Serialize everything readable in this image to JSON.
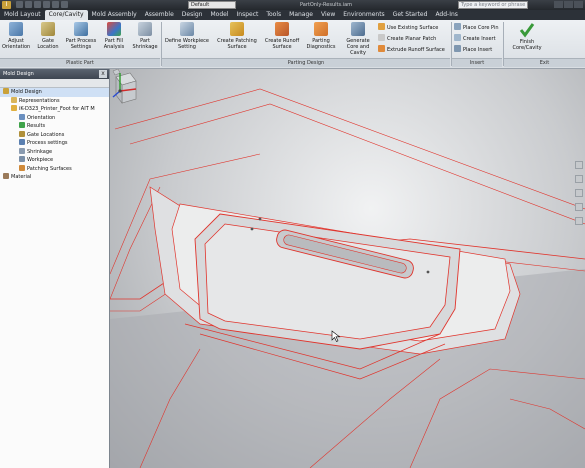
{
  "titlebar": {
    "app_button": "I",
    "style_combo": "Default",
    "document_title": "PartOnly-Results.iam",
    "search_placeholder": "Type a keyword or phrase"
  },
  "ribbon_tabs": [
    {
      "label": "Mold Layout",
      "active": false
    },
    {
      "label": "Core/Cavity",
      "active": true
    },
    {
      "label": "Mold Assembly",
      "active": false
    },
    {
      "label": "Assemble",
      "active": false
    },
    {
      "label": "Design",
      "active": false
    },
    {
      "label": "Model",
      "active": false
    },
    {
      "label": "Inspect",
      "active": false
    },
    {
      "label": "Tools",
      "active": false
    },
    {
      "label": "Manage",
      "active": false
    },
    {
      "label": "View",
      "active": false
    },
    {
      "label": "Environments",
      "active": false
    },
    {
      "label": "Get Started",
      "active": false
    },
    {
      "label": "Add-Ins",
      "active": false
    }
  ],
  "ribbon": {
    "plastic_part": {
      "label": "Plastic Part",
      "adjust_orientation": "Adjust Orientation",
      "gate_location": "Gate Location",
      "part_process_settings": "Part Process Settings",
      "part_fill_analysis": "Part Fill Analysis",
      "part_shrinkage": "Part Shrinkage"
    },
    "parting_design": {
      "label": "Parting Design",
      "define_workpiece_setting": "Define Workpiece Setting",
      "create_patching_surface": "Create Patching Surface",
      "create_runoff_surface": "Create Runoff Surface",
      "parting_diagnostics": "Parting Diagnostics",
      "generate_core_and_cavity": "Generate Core and Cavity",
      "use_existing_surface": "Use Existing Surface",
      "create_planar_patch": "Create Planar Patch",
      "extrude_runoff_surface": "Extrude Runoff Surface"
    },
    "insert": {
      "label": "Insert",
      "place_core_pin": "Place Core Pin",
      "create_insert": "Create Insert",
      "place_insert": "Place Insert"
    },
    "exit": {
      "label": "Exit",
      "finish_core_cavity": "Finish Core/Cavity"
    }
  },
  "browser": {
    "title": "Mold Design",
    "close_glyph": "x",
    "items": [
      {
        "label": "Mold Design",
        "indent": 0,
        "icon": "assembly-icon"
      },
      {
        "label": "Representations",
        "indent": 1,
        "icon": "folder-icon"
      },
      {
        "label": "iK-D323_Printer_Foot for AIT M",
        "indent": 1,
        "icon": "part-icon"
      },
      {
        "label": "Orientation",
        "indent": 2,
        "icon": "orientation-icon"
      },
      {
        "label": "Results",
        "indent": 2,
        "icon": "results-icon"
      },
      {
        "label": "Gate Locations",
        "indent": 2,
        "icon": "gate-icon"
      },
      {
        "label": "Process settings",
        "indent": 2,
        "icon": "settings-icon"
      },
      {
        "label": "Shrinkage",
        "indent": 2,
        "icon": "shrinkage-icon"
      },
      {
        "label": "Workpiece",
        "indent": 2,
        "icon": "workpiece-icon"
      },
      {
        "label": "Patching Surfaces",
        "indent": 2,
        "icon": "surface-icon"
      },
      {
        "label": "Material",
        "indent": 0,
        "icon": "material-icon"
      }
    ]
  },
  "colors": {
    "edge_highlight": "#e0342c",
    "model_edge": "#5a5d61",
    "ribbon_bg": "#e4e8ec",
    "title_bg": "#2c3138"
  }
}
